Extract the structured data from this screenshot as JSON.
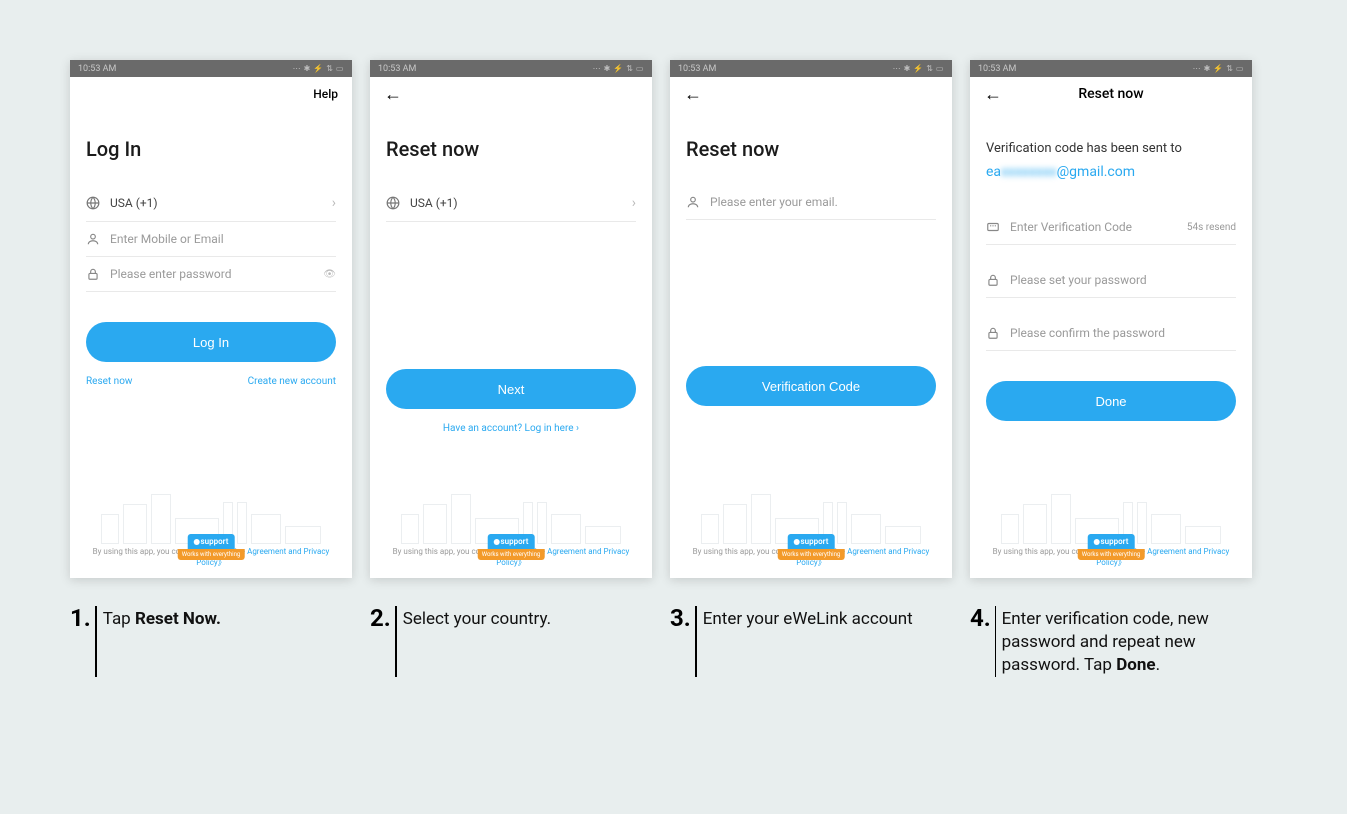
{
  "status": {
    "time": "10:53 AM",
    "icons": "⋯ ✱ ⚡  ⇅ ▭"
  },
  "s1": {
    "help": "Help",
    "heading": "Log In",
    "country": "USA (+1)",
    "userPH": "Enter Mobile or Email",
    "passPH": "Please enter password",
    "loginBtn": "Log In",
    "resetLink": "Reset now",
    "createLink": "Create new account"
  },
  "s2": {
    "heading": "Reset now",
    "country": "USA (+1)",
    "nextBtn": "Next",
    "haveAccount": "Have an account? Log in here ›"
  },
  "s3": {
    "heading": "Reset now",
    "emailPH": "Please enter your email.",
    "verifyBtn": "Verification Code"
  },
  "s4": {
    "title": "Reset now",
    "sentMsg": "Verification code has been sent to",
    "emailPrefix": "ea",
    "emailBlur": "xxxxxxxx",
    "emailSuffix": "@gmail.com",
    "codePH": "Enter Verification Code",
    "resend": "54s resend",
    "passPH": "Please set your password",
    "confirmPH": "Please confirm the password",
    "doneBtn": "Done"
  },
  "footer": {
    "badgeTop": "support",
    "badgeBottom": "Works with everything",
    "consentPre": "By using this app, you consent to ",
    "consentLink": "《Service Agreement and Privacy Policy》"
  },
  "captions": {
    "1": {
      "pre": "Tap ",
      "bold": "Reset Now."
    },
    "2": "Select your country.",
    "3": " Enter your eWeLink account",
    "4": {
      "pre": " Enter verification code, new password and repeat new password. Tap ",
      "bold": "Done",
      "post": "."
    }
  }
}
